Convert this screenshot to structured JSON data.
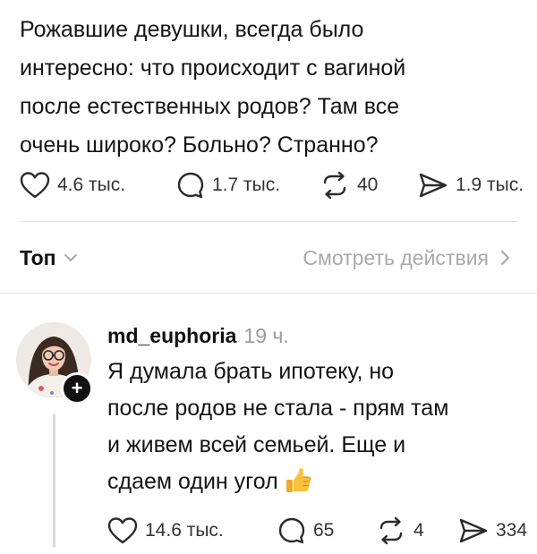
{
  "post": {
    "text_lines": [
      "Рожавшие девушки, всегда было",
      "интересно: что происходит с вагиной",
      "после естественных родов? Там все",
      "очень широко? Больно? Странно?"
    ],
    "likes": "4.6 тыс.",
    "replies": "1.7 тыс.",
    "reposts": "40",
    "shares": "1.9 тыс."
  },
  "sort": {
    "label": "Топ",
    "view_activity": "Смотреть действия"
  },
  "comment": {
    "username": "md_euphoria",
    "time": "19 ч.",
    "text_lines": [
      "Я думала брать ипотеку, но",
      "после родов не стала - прям там",
      "и живем всей семьей. Еще и",
      "сдаем один угол"
    ],
    "likes": "14.6 тыс.",
    "replies": "65",
    "reposts": "4",
    "shares": "334"
  },
  "colors": {
    "text": "#141414",
    "muted": "#9a9a9a",
    "icon": "#2b2b2b",
    "divider": "#e3e3e3"
  },
  "icons": {
    "like": "heart-icon",
    "reply": "speech-bubble-icon",
    "repost": "repost-icon",
    "share": "send-icon",
    "sort": "chevron-down-icon",
    "view": "chevron-right-icon",
    "follow": "plus-icon",
    "emoji": "thumbs-up-emoji"
  }
}
